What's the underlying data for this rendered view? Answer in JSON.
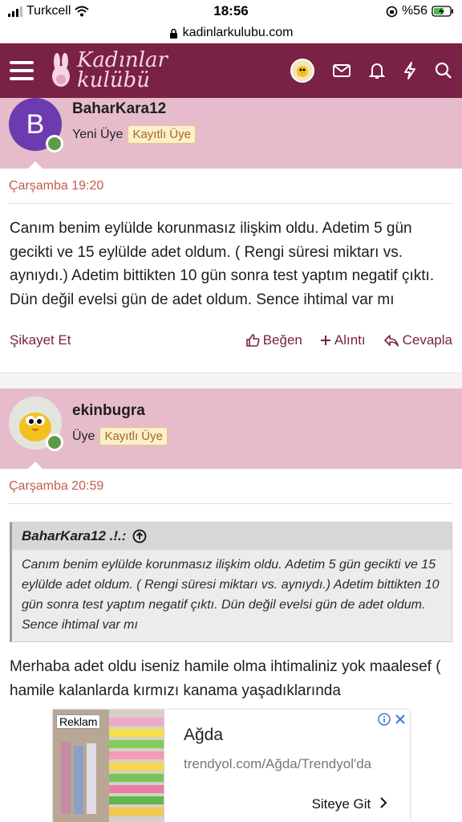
{
  "status": {
    "carrier": "Turkcell",
    "time": "18:56",
    "battery": "%56"
  },
  "browser": {
    "url": "kadinlarkulubu.com"
  },
  "header": {
    "logo_line1": "Kadınlar",
    "logo_line2": "kulübü",
    "accent": "#7a2146"
  },
  "posts": [
    {
      "avatar_letter": "B",
      "username": "BaharKara12",
      "role": "Yeni Üye",
      "badge": "Kayıtlı Üye",
      "date": "Çarşamba 19:20",
      "text": "Canım benim eylülde korunmasız ilişkim oldu. Adetim 5 gün gecikti ve 15 eylülde adet oldum. ( Rengi süresi miktarı vs. aynıydı.) Adetim bittikten 10 gün sonra test yaptım negatif çıktı. Dün değil evelsi gün de adet oldum. Sence ihtimal var mı",
      "actions": {
        "report": "Şikayet Et",
        "like": "Beğen",
        "quote": "Alıntı",
        "reply": "Cevapla"
      }
    },
    {
      "username": "ekinbugra",
      "role": "Üye",
      "badge": "Kayıtlı Üye",
      "date": "Çarşamba 20:59",
      "quote_author": "BaharKara12 .!.:",
      "quote_text": "Canım benim eylülde korunmasız ilişkim oldu. Adetim 5 gün gecikti ve 15 eylülde adet oldum. ( Rengi süresi miktarı vs. aynıydı.) Adetim bittikten 10 gün sonra test yaptım negatif çıktı. Dün değil evelsi gün de adet oldum. Sence ihtimal var mı",
      "text": "Merhaba adet oldu iseniz hamile olma ihtimaliniz yok maalesef ( hamile kalanlarda kırmızı kanama yaşadıklarında"
    }
  ],
  "ad": {
    "label": "Reklam",
    "title": "Ağda",
    "url": "trendyol.com/Ağda/Trendyol'da",
    "cta": "Siteye Git"
  }
}
